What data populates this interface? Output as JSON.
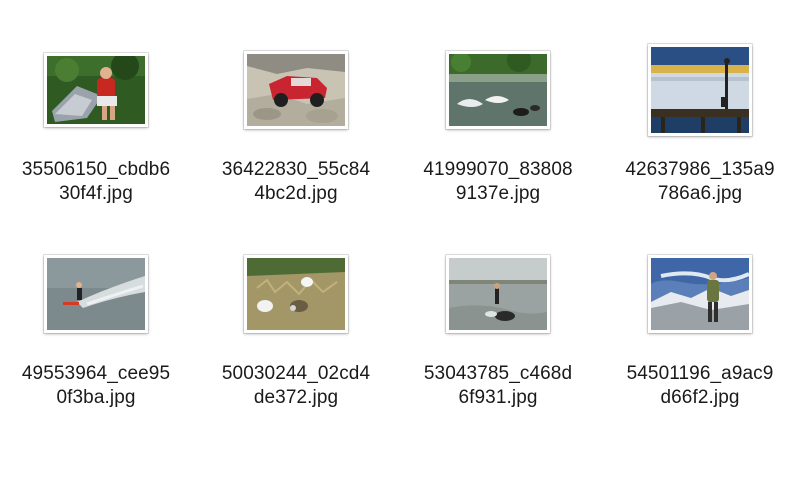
{
  "files": [
    {
      "name_line1": "35506150_cbdb6",
      "name_line2": "30f4f.jpg",
      "thumbnail": "person-on-rock-red-jacket"
    },
    {
      "name_line1": "36422830_55c84",
      "name_line2": "4bc2d.jpg",
      "thumbnail": "red-truck-on-rocks"
    },
    {
      "name_line1": "41999070_83808",
      "name_line2": "9137e.jpg",
      "thumbnail": "dogs-swimming-in-pond"
    },
    {
      "name_line1": "42637986_135a9",
      "name_line2": "786a6.jpg",
      "thumbnail": "person-on-pier-at-sunset"
    },
    {
      "name_line1": "49553964_cee95",
      "name_line2": "0f3ba.jpg",
      "thumbnail": "water-skier"
    },
    {
      "name_line1": "50030244_02cd4",
      "name_line2": "de372.jpg",
      "thumbnail": "animals-in-dry-grass"
    },
    {
      "name_line1": "53043785_c468d",
      "name_line2": "6f931.jpg",
      "thumbnail": "person-and-dog-at-lake"
    },
    {
      "name_line1": "54501196_a9ac9",
      "name_line2": "d66f2.jpg",
      "thumbnail": "hiker-with-mountains"
    }
  ]
}
